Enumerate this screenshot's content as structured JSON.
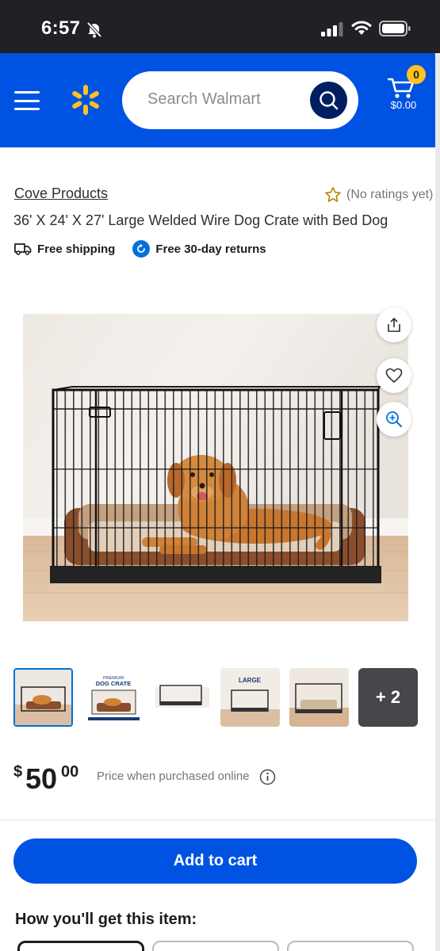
{
  "status_bar": {
    "time": "6:57"
  },
  "header": {
    "search": {
      "placeholder": "Search Walmart"
    },
    "cart": {
      "count": "0",
      "total": "$0.00"
    }
  },
  "product": {
    "brand": "Cove Products",
    "rating_text": "(No ratings yet)",
    "title": "36' X 24' X 27' Large Welded Wire Dog Crate with Bed Dog",
    "badges": {
      "shipping": "Free shipping",
      "returns": "Free 30-day returns"
    },
    "thumbnail_more": "+ 2",
    "thumbnail_text": {
      "premium": "PREMIUM",
      "dog_crate": "DOG CRATE",
      "large": "LARGE"
    },
    "price": {
      "currency": "$",
      "dollars": "50",
      "cents": "00",
      "note": "Price when purchased online"
    }
  },
  "actions": {
    "add_to_cart": "Add to cart"
  },
  "fulfillment": {
    "heading": "How you'll get this item:"
  },
  "colors": {
    "brand_blue": "#0053e2",
    "spark_yellow": "#ffc220",
    "navy": "#001e60",
    "link_blue": "#0071dc"
  }
}
